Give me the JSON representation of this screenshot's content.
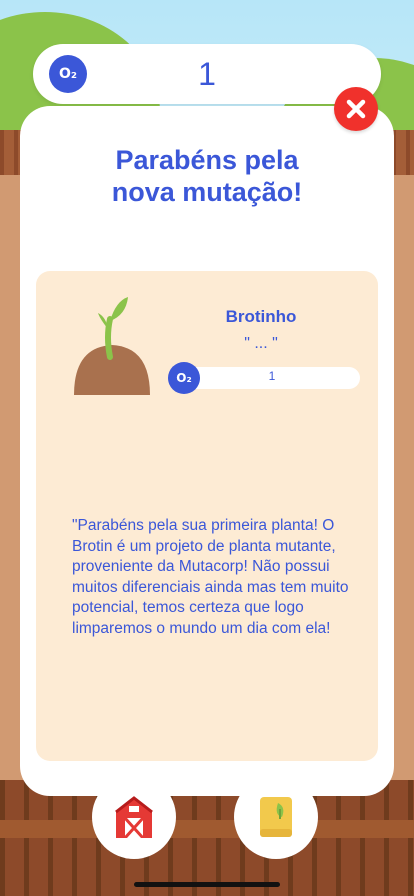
{
  "o2_bar": {
    "badge": "O₂",
    "value": "1"
  },
  "close": {
    "icon": "close-icon",
    "color": "#f0312c"
  },
  "modal": {
    "title": "Parabéns pela nova mutação!",
    "plant": {
      "name": "Brotinho",
      "quote": "\" ... \"",
      "badge": "O₂",
      "o2_value": "1"
    },
    "description": "\"Parabéns pela sua primeira planta! O Brotin é um projeto de planta mutante, proveniente da Mutacorp! Não possui muitos diferenciais ainda mas tem muito potencial, temos certeza que logo limparemos o mundo um dia com ela!"
  },
  "nav": [
    {
      "icon": "barn-icon"
    },
    {
      "icon": "book-icon"
    }
  ],
  "colors": {
    "accent": "#3b57d8",
    "card": "#fdebd4",
    "close": "#f0312c"
  }
}
